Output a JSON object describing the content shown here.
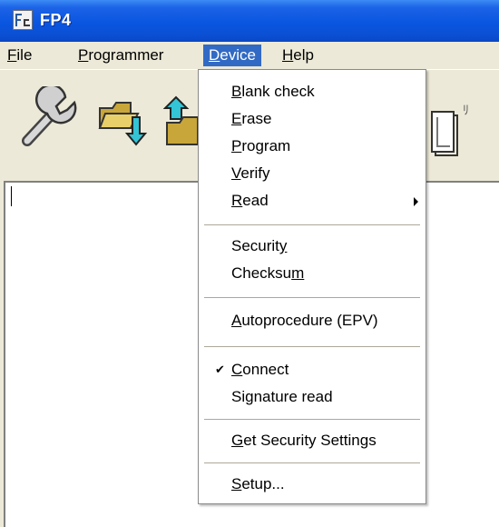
{
  "window": {
    "title": "FP4",
    "app_icon": "fp4-app-icon"
  },
  "menubar": {
    "items": [
      {
        "label": "File",
        "mnemonic": "F",
        "rest": "ile"
      },
      {
        "label": "Programmer",
        "mnemonic": "P",
        "rest": "rogrammer"
      },
      {
        "label": "Device",
        "mnemonic": "D",
        "rest": "evice",
        "active": true
      },
      {
        "label": "Help",
        "mnemonic": "H",
        "rest": "elp"
      }
    ]
  },
  "toolbar": {
    "buttons": [
      {
        "icon": "wrench-icon"
      },
      {
        "icon": "open-folder-icon"
      },
      {
        "icon": "folder-upload-icon"
      },
      {
        "icon": "document-icon"
      }
    ],
    "overflow_text": "ﾘ"
  },
  "device_menu": {
    "items": [
      {
        "pre": "",
        "mn": "B",
        "post": "lank check"
      },
      {
        "pre": "",
        "mn": "E",
        "post": "rase"
      },
      {
        "pre": "",
        "mn": "P",
        "post": "rogram"
      },
      {
        "pre": "",
        "mn": "V",
        "post": "erify"
      },
      {
        "pre": "",
        "mn": "R",
        "post": "ead",
        "submenu": true
      },
      {
        "pre": "Securit",
        "mn": "y",
        "post": ""
      },
      {
        "pre": "Checksu",
        "mn": "m",
        "post": ""
      },
      {
        "pre": "",
        "mn": "A",
        "post": "utoprocedure (EPV)"
      },
      {
        "pre": "",
        "mn": "C",
        "post": "onnect",
        "checked": true
      },
      {
        "pre": "Si",
        "mn": "g",
        "post": "nature read"
      },
      {
        "pre": "",
        "mn": "G",
        "post": "et Security Settings"
      },
      {
        "pre": "",
        "mn": "S",
        "post": "etup..."
      }
    ],
    "check_glyph": "✔"
  },
  "colors": {
    "title_bar": "#0a56e0",
    "menu_highlight": "#316ac5",
    "chrome": "#ece9d8"
  }
}
